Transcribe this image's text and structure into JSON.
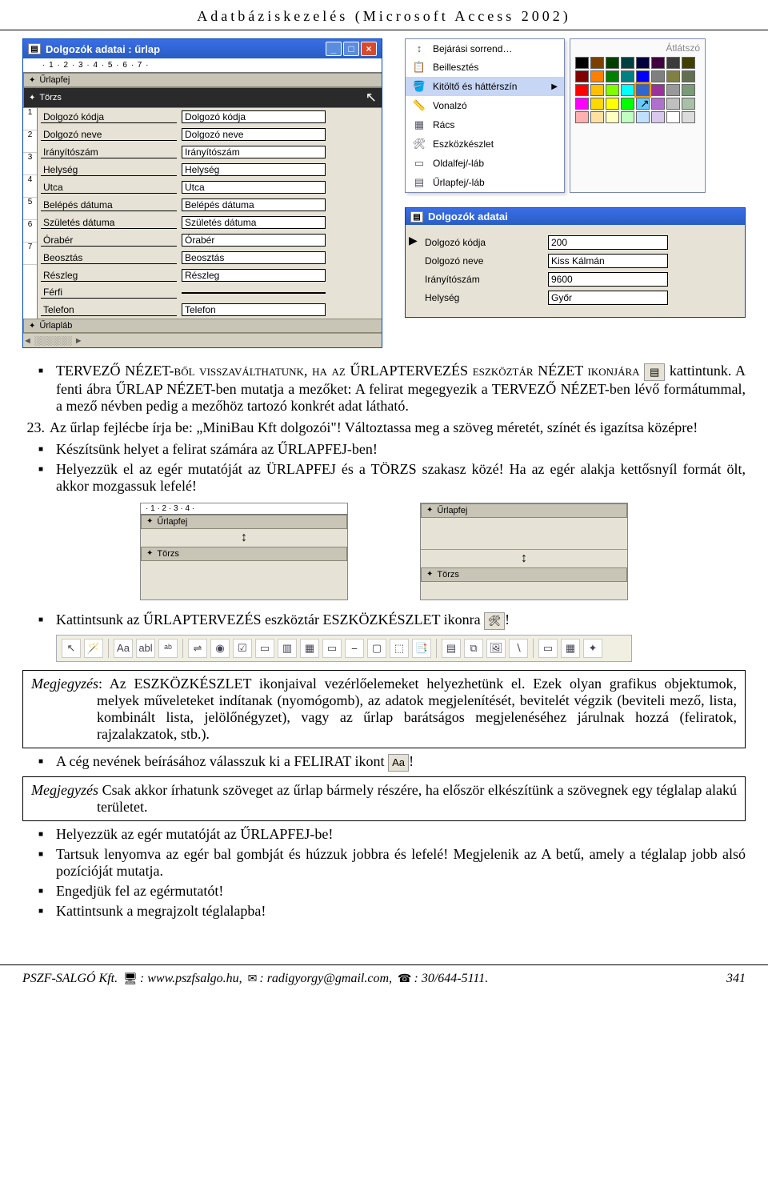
{
  "header": "Adatbáziskezelés (Microsoft Access 2002)",
  "designer_window": {
    "title": "Dolgozók adatai : űrlap",
    "ruler": "· 1 · 2 · 3 · 4 · 5 · 6 · 7 ·",
    "bands": {
      "header": "Űrlapfej",
      "detail": "Törzs",
      "footer": "Űrlapláb"
    },
    "fields": [
      {
        "label": "Dolgozó kódja",
        "source": "Dolgozó kódja"
      },
      {
        "label": "Dolgozó neve",
        "source": "Dolgozó neve"
      },
      {
        "label": "Irányítószám",
        "source": "Irányítószám"
      },
      {
        "label": "Helység",
        "source": "Helység"
      },
      {
        "label": "Utca",
        "source": "Utca"
      },
      {
        "label": "Belépés dátuma",
        "source": "Belépés dátuma"
      },
      {
        "label": "Születés dátuma",
        "source": "Születés dátuma"
      },
      {
        "label": "Órabér",
        "source": "Órabér"
      },
      {
        "label": "Beosztás",
        "source": "Beosztás"
      },
      {
        "label": "Részleg",
        "source": "Részleg"
      },
      {
        "label": "Férfi",
        "source": ""
      },
      {
        "label": "Telefon",
        "source": "Telefon"
      }
    ]
  },
  "context_menu": {
    "items": [
      {
        "icon": "↕",
        "label": "Bejárási sorrend…"
      },
      {
        "icon": "📋",
        "label": "Beillesztés"
      },
      {
        "icon": "🪣",
        "label": "Kitöltő és háttérszín",
        "sub": true,
        "selected": true
      },
      {
        "icon": "📏",
        "label": "Vonalzó"
      },
      {
        "icon": "▦",
        "label": "Rács"
      },
      {
        "icon": "🛠",
        "label": "Eszközkészlet"
      },
      {
        "icon": "▭",
        "label": "Oldalfej/-láb"
      },
      {
        "icon": "▤",
        "label": "Űrlapfej/-láb"
      }
    ]
  },
  "palette": {
    "transparent": "Átlátszó",
    "colors": [
      "#000000",
      "#7b3f00",
      "#003f00",
      "#003f3f",
      "#00003f",
      "#3f003f",
      "#3b3b3b",
      "#3f3f00",
      "#800000",
      "#ff8000",
      "#008000",
      "#008080",
      "#0000ff",
      "#7f7f7f",
      "#808040",
      "#607050",
      "#ff0000",
      "#ffc000",
      "#80ff00",
      "#00ffff",
      "#3366cc",
      "#993399",
      "#999999",
      "#7a9a7a",
      "#ff00ff",
      "#ffd800",
      "#ffff00",
      "#00ff00",
      "#66ccff",
      "#b070d0",
      "#c0c0c0",
      "#a8c0a8",
      "#ffb0b0",
      "#ffe0a0",
      "#ffffc0",
      "#c0ffc0",
      "#c0e0ff",
      "#d8c8ec",
      "#ffffff",
      "#dcdcdc"
    ],
    "selected_index": 20
  },
  "form_view": {
    "title": "Dolgozók adatai",
    "rows": [
      {
        "label": "Dolgozó kódja",
        "value": "200"
      },
      {
        "label": "Dolgozó neve",
        "value": "Kiss Kálmán"
      },
      {
        "label": "Irányítószám",
        "value": "9600"
      },
      {
        "label": "Helység",
        "value": "Győr"
      }
    ]
  },
  "body": {
    "b1a": "TERVEZŐ NÉZET-ből visszaválthatunk, ha az ŰRLAPTERVEZÉS eszköztár NÉZET ikonjára",
    "b1b": "kattintunk. A fenti ábra ŰRLAP NÉZET-ben mutatja a mezőket: A felirat megegyezik a TERVEZŐ NÉZET-ben lévő formátummal, a mező névben pedig a mezőhöz tartozó konkrét adat látható.",
    "n23": "Az űrlap fejlécbe írja be: „MiniBau Kft dolgozói\"! Változtassa meg a szöveg méretét, színét és igazítsa középre!",
    "b2": "Készítsünk helyet a felirat számára az ŰRLAPFEJ-ben!",
    "b3": "Helyezzük el az egér mutatóját az ÜRLAPFEJ és a TÖRZS szakasz közé! Ha az egér alakja kettősnyíl formát ölt, akkor mozgassuk lefelé!",
    "b4a": "Kattintsunk az ŰRLAPTERVEZÉS eszköztár ESZKÖZKÉSZLET ikonra",
    "b4b": "!",
    "note1": "Az ESZKÖZKÉSZLET ikonjaival vezérlőelemeket helyezhetünk el. Ezek olyan grafikus objektumok, melyek műveleteket indítanak (nyomógomb), az adatok megjelenítését, bevitelét végzik (beviteli mező, lista, kombinált lista, jelölőnégyzet), vagy az űrlap barátságos megjelenéséhez járulnak hozzá (feliratok, rajzalakzatok, stb.).",
    "b5a": "A cég nevének beírásához válasszuk ki a FELIRAT ikont",
    "b5b": "!",
    "note2": "Csak akkor írhatunk szöveget az űrlap bármely részére, ha először elkészítünk a szövegnek egy téglalap alakú területet.",
    "b6": "Helyezzük az egér mutatóját az ŰRLAPFEJ-be!",
    "b7": "Tartsuk lenyomva az egér bal gombját és húzzuk jobbra és lefelé! Megjelenik az A betű, amely a téglalap jobb alsó pozícióját mutatja.",
    "b8": "Engedjük fel az egérmutatót!",
    "b9": "Kattintsunk a megrajzolt téglalapba!"
  },
  "snippet": {
    "ruler1": "· 1 · 2 · 3 · 4 ·",
    "header": "Űrlapfej",
    "detail": "Törzs"
  },
  "toolbar": {
    "buttons": [
      "↖",
      "🪄",
      "Aa",
      "abl",
      "ᵃᵇ",
      "⇌",
      "◉",
      "☑",
      "▭",
      "▥",
      "▦",
      "▭",
      "⎯",
      "▢",
      "⬚",
      "📑",
      "▤",
      "⧉",
      "🖼",
      "∖",
      "▭",
      "▦",
      "✦"
    ]
  },
  "icons": {
    "view": "▤",
    "tools": "🛠",
    "label": "Aa"
  },
  "note_prefix": "Megjegyzés",
  "colon": ": ",
  "footer": {
    "company": "PSZF-SALGÓ Kft.",
    "web": "www.pszfsalgo.hu",
    "email": "radigyorgy@gmail.com",
    "phone": "30/644-5111.",
    "page": "341"
  }
}
